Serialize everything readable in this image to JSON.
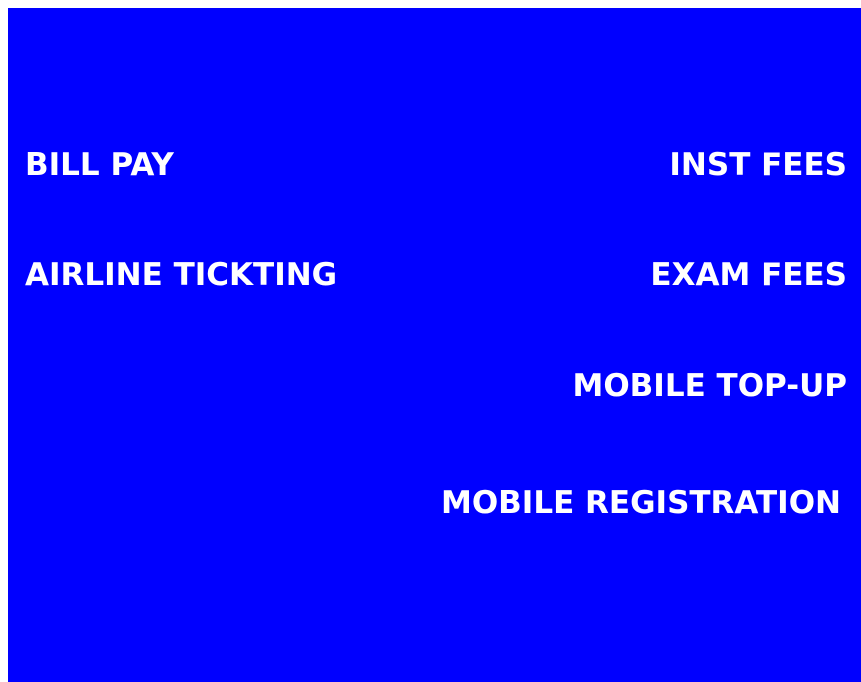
{
  "menu": {
    "left": [
      {
        "label": "BILL PAY"
      },
      {
        "label": "AIRLINE TICKTING"
      }
    ],
    "right": [
      {
        "label": "INST FEES"
      },
      {
        "label": "EXAM FEES"
      },
      {
        "label": "MOBILE TOP-UP"
      },
      {
        "label": "MOBILE REGISTRATION"
      }
    ]
  },
  "colors": {
    "background": "#0000ff",
    "text": "#ffffff"
  }
}
